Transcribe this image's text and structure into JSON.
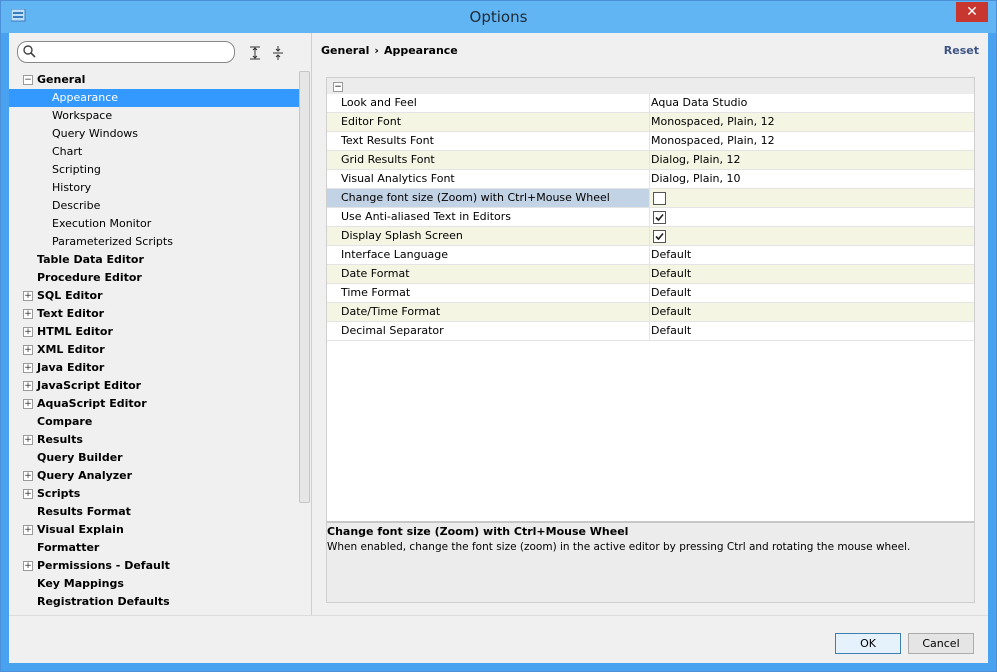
{
  "window": {
    "title": "Options",
    "close_symbol": "✕"
  },
  "search": {
    "value": "",
    "placeholder": ""
  },
  "tree": [
    {
      "label": "General",
      "bold": true,
      "expander": "−"
    },
    {
      "label": "Appearance",
      "child": true,
      "selected": true
    },
    {
      "label": "Workspace",
      "child": true
    },
    {
      "label": "Query Windows",
      "child": true
    },
    {
      "label": "Chart",
      "child": true
    },
    {
      "label": "Scripting",
      "child": true
    },
    {
      "label": "History",
      "child": true
    },
    {
      "label": "Describe",
      "child": true
    },
    {
      "label": "Execution Monitor",
      "child": true
    },
    {
      "label": "Parameterized Scripts",
      "child": true
    },
    {
      "label": "Table Data Editor",
      "bold": true
    },
    {
      "label": "Procedure Editor",
      "bold": true
    },
    {
      "label": "SQL Editor",
      "bold": true,
      "expander": "+"
    },
    {
      "label": "Text Editor",
      "bold": true,
      "expander": "+"
    },
    {
      "label": "HTML Editor",
      "bold": true,
      "expander": "+"
    },
    {
      "label": "XML Editor",
      "bold": true,
      "expander": "+"
    },
    {
      "label": "Java Editor",
      "bold": true,
      "expander": "+"
    },
    {
      "label": "JavaScript Editor",
      "bold": true,
      "expander": "+"
    },
    {
      "label": "AquaScript Editor",
      "bold": true,
      "expander": "+"
    },
    {
      "label": "Compare",
      "bold": true
    },
    {
      "label": "Results",
      "bold": true,
      "expander": "+"
    },
    {
      "label": "Query Builder",
      "bold": true
    },
    {
      "label": "Query Analyzer",
      "bold": true,
      "expander": "+"
    },
    {
      "label": "Scripts",
      "bold": true,
      "expander": "+"
    },
    {
      "label": "Results Format",
      "bold": true
    },
    {
      "label": "Visual Explain",
      "bold": true,
      "expander": "+"
    },
    {
      "label": "Formatter",
      "bold": true
    },
    {
      "label": "Permissions - Default",
      "bold": true,
      "expander": "+"
    },
    {
      "label": "Key Mappings",
      "bold": true
    },
    {
      "label": "Registration Defaults",
      "bold": true
    }
  ],
  "breadcrumb": {
    "parent": "General",
    "separator": "›",
    "current": "Appearance"
  },
  "reset_label": "Reset",
  "properties_collapse": "−",
  "properties": [
    {
      "key": "Look and Feel",
      "value": "Aqua Data Studio"
    },
    {
      "key": "Editor Font",
      "value": "Monospaced, Plain, 12"
    },
    {
      "key": "Text Results Font",
      "value": "Monospaced, Plain, 12"
    },
    {
      "key": "Grid Results Font",
      "value": "Dialog, Plain, 12"
    },
    {
      "key": "Visual Analytics Font",
      "value": "Dialog, Plain, 10"
    },
    {
      "key": "Change font size (Zoom) with Ctrl+Mouse Wheel",
      "checkbox": true,
      "checked": false,
      "highlight": true
    },
    {
      "key": "Use Anti-aliased Text in Editors",
      "checkbox": true,
      "checked": true
    },
    {
      "key": "Display Splash Screen",
      "checkbox": true,
      "checked": true
    },
    {
      "key": "Interface Language",
      "value": "Default"
    },
    {
      "key": "Date Format",
      "value": "Default"
    },
    {
      "key": "Time Format",
      "value": "Default"
    },
    {
      "key": "Date/Time Format",
      "value": "Default"
    },
    {
      "key": "Decimal Separator",
      "value": "Default"
    }
  ],
  "description": {
    "title": "Change font size (Zoom) with Ctrl+Mouse Wheel",
    "text": "When enabled, change the font size (zoom) in the active editor by pressing Ctrl and rotating the mouse wheel."
  },
  "buttons": {
    "ok": "OK",
    "cancel": "Cancel"
  },
  "colors": {
    "titlebar": "#62b5f3",
    "selection": "#3399ff",
    "close": "#c7372f",
    "alt_row": "#f5f5e3",
    "highlight_row": "#c3d3e6"
  },
  "icons": [
    "app-icon",
    "search-icon",
    "expand-all-icon",
    "collapse-all-icon",
    "close-icon",
    "checkmark-icon"
  ]
}
